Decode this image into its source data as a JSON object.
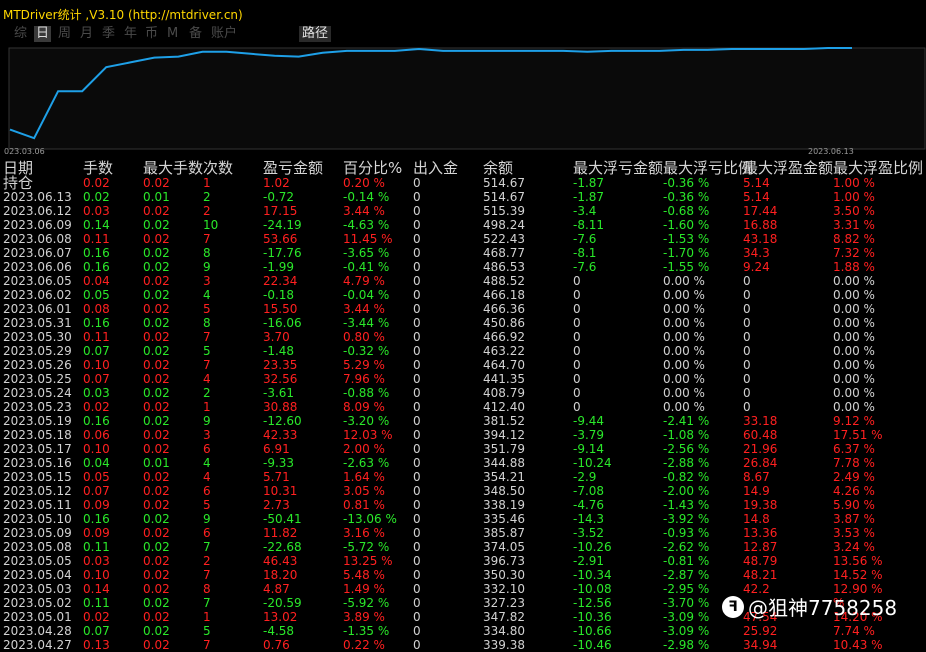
{
  "window": {
    "title": "MTDriver统计 ,V3.10 (http://mtdriver.cn)"
  },
  "tabs": [
    {
      "label": "综",
      "active": false
    },
    {
      "label": "日",
      "active": true
    },
    {
      "label": "周",
      "active": false
    },
    {
      "label": "月",
      "active": false
    },
    {
      "label": "季",
      "active": false
    },
    {
      "label": "年",
      "active": false
    },
    {
      "label": "币",
      "active": false
    },
    {
      "label": "M",
      "active": false
    },
    {
      "label": "备",
      "active": false
    },
    {
      "label": "账户",
      "active": false
    },
    {
      "label": "路径",
      "active": false
    }
  ],
  "chart_data": {
    "type": "line",
    "x_start_label": "023.03.06",
    "x_end_label": "2023.06.13",
    "line_color": "#1ea0e8",
    "values": [
      0.15,
      0.06,
      0.55,
      0.55,
      0.8,
      0.85,
      0.9,
      0.91,
      0.96,
      0.96,
      0.94,
      0.92,
      0.91,
      0.95,
      0.97,
      0.97,
      0.97,
      0.99,
      0.97,
      0.97,
      0.97,
      0.97,
      0.97,
      0.97,
      0.96,
      0.97,
      0.97,
      0.97,
      0.98,
      0.98,
      0.99,
      0.99,
      0.99,
      0.99,
      1.0,
      1.0
    ]
  },
  "colors": {
    "red": "#ff2020",
    "green": "#2ae82a",
    "white": "#d2d2d2"
  },
  "table": {
    "headers": [
      "日期",
      "手数",
      "最大手数",
      "次数",
      "盈亏金额",
      "百分比%",
      "出入金",
      "余额",
      "最大浮亏金额",
      "最大浮亏比例",
      "最大浮盈金额",
      "最大浮盈比例"
    ],
    "rows": [
      {
        "c": [
          "持仓",
          "0.02",
          "0.02",
          "1",
          "1.02",
          "0.20 %",
          "0",
          "514.67",
          "-1.87",
          "-0.36 %",
          "5.14",
          "1.00 %"
        ],
        "s": "r"
      },
      {
        "c": [
          "2023.06.13",
          "0.02",
          "0.01",
          "2",
          "-0.72",
          "-0.14 %",
          "0",
          "514.67",
          "-1.87",
          "-0.36 %",
          "5.14",
          "1.00 %"
        ],
        "s": "g"
      },
      {
        "c": [
          "2023.06.12",
          "0.03",
          "0.02",
          "2",
          "17.15",
          "3.44 %",
          "0",
          "515.39",
          "-3.4",
          "-0.68 %",
          "17.44",
          "3.50 %"
        ],
        "s": "r"
      },
      {
        "c": [
          "2023.06.09",
          "0.14",
          "0.02",
          "10",
          "-24.19",
          "-4.63 %",
          "0",
          "498.24",
          "-8.11",
          "-1.60 %",
          "16.88",
          "3.31 %"
        ],
        "s": "g"
      },
      {
        "c": [
          "2023.06.08",
          "0.11",
          "0.02",
          "7",
          "53.66",
          "11.45 %",
          "0",
          "522.43",
          "-7.6",
          "-1.53 %",
          "43.18",
          "8.82 %"
        ],
        "s": "r"
      },
      {
        "c": [
          "2023.06.07",
          "0.16",
          "0.02",
          "8",
          "-17.76",
          "-3.65 %",
          "0",
          "468.77",
          "-8.1",
          "-1.70 %",
          "34.3",
          "7.32 %"
        ],
        "s": "g"
      },
      {
        "c": [
          "2023.06.06",
          "0.16",
          "0.02",
          "9",
          "-1.99",
          "-0.41 %",
          "0",
          "486.53",
          "-7.6",
          "-1.55 %",
          "9.24",
          "1.88 %"
        ],
        "s": "g"
      },
      {
        "c": [
          "2023.06.05",
          "0.04",
          "0.02",
          "3",
          "22.34",
          "4.79 %",
          "0",
          "488.52",
          "0",
          "0.00 %",
          "0",
          "0.00 %"
        ],
        "s": "r"
      },
      {
        "c": [
          "2023.06.02",
          "0.05",
          "0.02",
          "4",
          "-0.18",
          "-0.04 %",
          "0",
          "466.18",
          "0",
          "0.00 %",
          "0",
          "0.00 %"
        ],
        "s": "g"
      },
      {
        "c": [
          "2023.06.01",
          "0.08",
          "0.02",
          "5",
          "15.50",
          "3.44 %",
          "0",
          "466.36",
          "0",
          "0.00 %",
          "0",
          "0.00 %"
        ],
        "s": "r"
      },
      {
        "c": [
          "2023.05.31",
          "0.16",
          "0.02",
          "8",
          "-16.06",
          "-3.44 %",
          "0",
          "450.86",
          "0",
          "0.00 %",
          "0",
          "0.00 %"
        ],
        "s": "g"
      },
      {
        "c": [
          "2023.05.30",
          "0.11",
          "0.02",
          "7",
          "3.70",
          "0.80 %",
          "0",
          "466.92",
          "0",
          "0.00 %",
          "0",
          "0.00 %"
        ],
        "s": "r"
      },
      {
        "c": [
          "2023.05.29",
          "0.07",
          "0.02",
          "5",
          "-1.48",
          "-0.32 %",
          "0",
          "463.22",
          "0",
          "0.00 %",
          "0",
          "0.00 %"
        ],
        "s": "g"
      },
      {
        "c": [
          "2023.05.26",
          "0.10",
          "0.02",
          "7",
          "23.35",
          "5.29 %",
          "0",
          "464.70",
          "0",
          "0.00 %",
          "0",
          "0.00 %"
        ],
        "s": "r"
      },
      {
        "c": [
          "2023.05.25",
          "0.07",
          "0.02",
          "4",
          "32.56",
          "7.96 %",
          "0",
          "441.35",
          "0",
          "0.00 %",
          "0",
          "0.00 %"
        ],
        "s": "r"
      },
      {
        "c": [
          "2023.05.24",
          "0.03",
          "0.02",
          "2",
          "-3.61",
          "-0.88 %",
          "0",
          "408.79",
          "0",
          "0.00 %",
          "0",
          "0.00 %"
        ],
        "s": "g"
      },
      {
        "c": [
          "2023.05.23",
          "0.02",
          "0.02",
          "1",
          "30.88",
          "8.09 %",
          "0",
          "412.40",
          "0",
          "0.00 %",
          "0",
          "0.00 %"
        ],
        "s": "r"
      },
      {
        "c": [
          "2023.05.19",
          "0.16",
          "0.02",
          "9",
          "-12.60",
          "-3.20 %",
          "0",
          "381.52",
          "-9.44",
          "-2.41 %",
          "33.18",
          "9.12 %"
        ],
        "s": "g"
      },
      {
        "c": [
          "2023.05.18",
          "0.06",
          "0.02",
          "3",
          "42.33",
          "12.03 %",
          "0",
          "394.12",
          "-3.79",
          "-1.08 %",
          "60.48",
          "17.51 %"
        ],
        "s": "r"
      },
      {
        "c": [
          "2023.05.17",
          "0.10",
          "0.02",
          "6",
          "6.91",
          "2.00 %",
          "0",
          "351.79",
          "-9.14",
          "-2.56 %",
          "21.96",
          "6.37 %"
        ],
        "s": "r"
      },
      {
        "c": [
          "2023.05.16",
          "0.04",
          "0.01",
          "4",
          "-9.33",
          "-2.63 %",
          "0",
          "344.88",
          "-10.24",
          "-2.88 %",
          "26.84",
          "7.78 %"
        ],
        "s": "g"
      },
      {
        "c": [
          "2023.05.15",
          "0.05",
          "0.02",
          "4",
          "5.71",
          "1.64 %",
          "0",
          "354.21",
          "-2.9",
          "-0.82 %",
          "8.67",
          "2.49 %"
        ],
        "s": "r"
      },
      {
        "c": [
          "2023.05.12",
          "0.07",
          "0.02",
          "6",
          "10.31",
          "3.05 %",
          "0",
          "348.50",
          "-7.08",
          "-2.00 %",
          "14.9",
          "4.26 %"
        ],
        "s": "r"
      },
      {
        "c": [
          "2023.05.11",
          "0.09",
          "0.02",
          "5",
          "2.73",
          "0.81 %",
          "0",
          "338.19",
          "-4.76",
          "-1.43 %",
          "19.38",
          "5.90 %"
        ],
        "s": "r"
      },
      {
        "c": [
          "2023.05.10",
          "0.16",
          "0.02",
          "9",
          "-50.41",
          "-13.06 %",
          "0",
          "335.46",
          "-14.3",
          "-3.92 %",
          "14.8",
          "3.87 %"
        ],
        "s": "g"
      },
      {
        "c": [
          "2023.05.09",
          "0.09",
          "0.02",
          "6",
          "11.82",
          "3.16 %",
          "0",
          "385.87",
          "-3.52",
          "-0.93 %",
          "13.36",
          "3.53 %"
        ],
        "s": "r"
      },
      {
        "c": [
          "2023.05.08",
          "0.11",
          "0.02",
          "7",
          "-22.68",
          "-5.72 %",
          "0",
          "374.05",
          "-10.26",
          "-2.62 %",
          "12.87",
          "3.24 %"
        ],
        "s": "g"
      },
      {
        "c": [
          "2023.05.05",
          "0.03",
          "0.02",
          "2",
          "46.43",
          "13.25 %",
          "0",
          "396.73",
          "-2.91",
          "-0.81 %",
          "48.79",
          "13.56 %"
        ],
        "s": "r"
      },
      {
        "c": [
          "2023.05.04",
          "0.10",
          "0.02",
          "7",
          "18.20",
          "5.48 %",
          "0",
          "350.30",
          "-10.34",
          "-2.87 %",
          "48.21",
          "14.52 %"
        ],
        "s": "r"
      },
      {
        "c": [
          "2023.05.03",
          "0.14",
          "0.02",
          "8",
          "4.87",
          "1.49 %",
          "0",
          "332.10",
          "-10.08",
          "-2.95 %",
          "42.2",
          "12.90 %"
        ],
        "s": "r"
      },
      {
        "c": [
          "2023.05.02",
          "0.11",
          "0.02",
          "7",
          "-20.59",
          "-5.92 %",
          "0",
          "327.23",
          "-12.56",
          "-3.70 %",
          "",
          "%"
        ],
        "s": "g"
      },
      {
        "c": [
          "2023.05.01",
          "0.02",
          "0.02",
          "1",
          "13.02",
          "3.89 %",
          "0",
          "347.82",
          "-10.36",
          "-3.09 %",
          "47.54",
          "14.20 %"
        ],
        "s": "r"
      },
      {
        "c": [
          "2023.04.28",
          "0.07",
          "0.02",
          "5",
          "-4.58",
          "-1.35 %",
          "0",
          "334.80",
          "-10.66",
          "-3.09 %",
          "25.92",
          "7.74 %"
        ],
        "s": "g"
      },
      {
        "c": [
          "2023.04.27",
          "0.13",
          "0.02",
          "7",
          "0.76",
          "0.22 %",
          "0",
          "339.38",
          "-10.46",
          "-2.98 %",
          "34.94",
          "10.43 %"
        ],
        "s": "r"
      }
    ]
  },
  "watermark": {
    "icon": "weibo-icon",
    "text": "@狙神7758258"
  }
}
